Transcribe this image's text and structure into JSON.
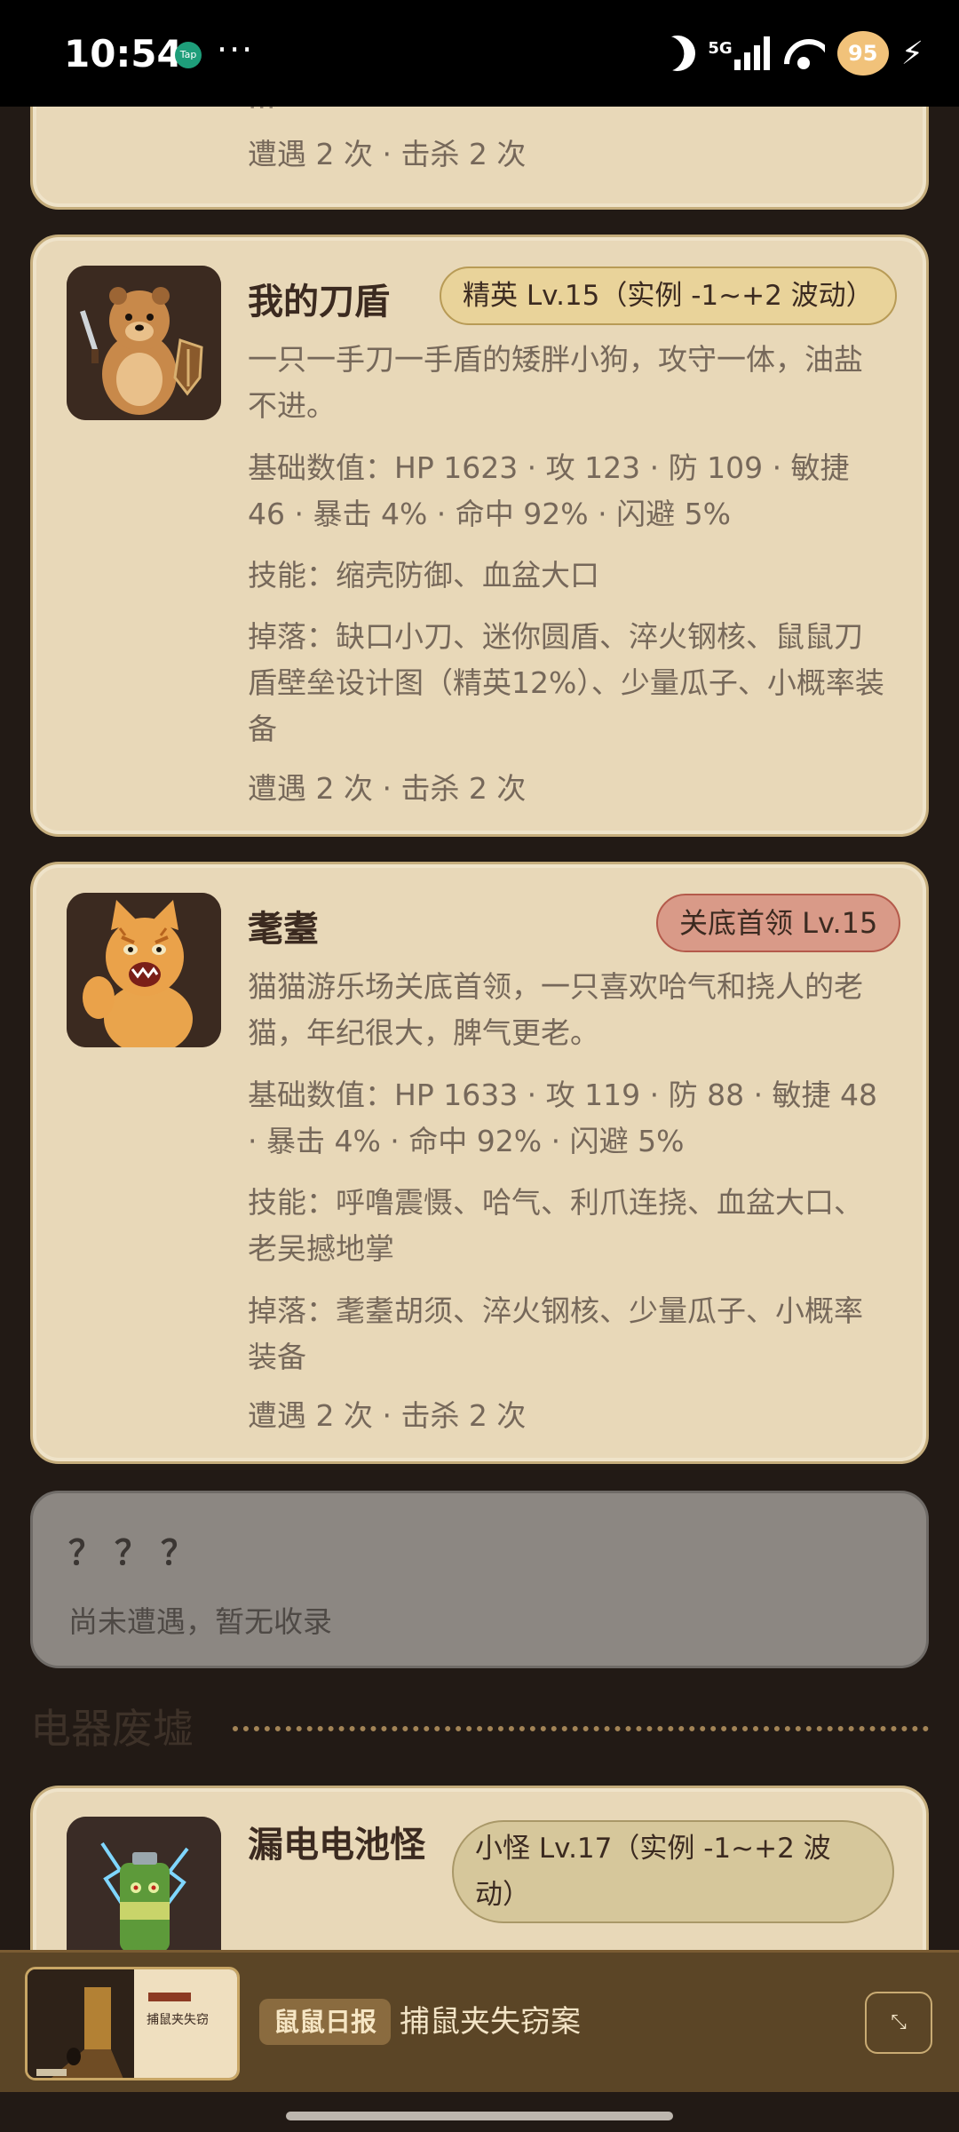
{
  "status_bar": {
    "time": "10:54",
    "app_badge": "Tap",
    "dots": "···",
    "network": "5G",
    "battery": "95",
    "icons": [
      "moon-icon",
      "signal-icon",
      "wifi-icon",
      "battery-icon",
      "charging-icon"
    ]
  },
  "cards": [
    {
      "encounter": "遭遇 2 次 · 击杀 2 次",
      "partial_text": "..."
    },
    {
      "name": "我的刀盾",
      "badge": "精英 Lv.15（实例 -1~+2 波动）",
      "description": "一只一手刀一手盾的矮胖小狗，攻守一体，油盐不进。",
      "stats": "基础数值：HP 1623 · 攻 123 · 防 109 · 敏捷 46 · 暴击 4% · 命中 92% · 闪避 5%",
      "skills": "技能：缩壳防御、血盆大口",
      "drops": "掉落：缺口小刀、迷你圆盾、淬火钢核、鼠鼠刀盾壁垒设计图（精英12%）、少量瓜子、小概率装备",
      "encounter": "遭遇 2 次 · 击杀 2 次"
    },
    {
      "name": "耄耋",
      "badge": "关底首领 Lv.15",
      "description": "猫猫游乐场关底首领，一只喜欢哈气和挠人的老猫，年纪很大，脾气更老。",
      "stats": "基础数值：HP 1633 · 攻 119 · 防 88 · 敏捷 48 · 暴击 4% · 命中 92% · 闪避 5%",
      "skills": "技能：呼噜震慑、哈气、利爪连挠、血盆大口、老吴撼地掌",
      "drops": "掉落：耄耋胡须、淬火钢核、少量瓜子、小概率装备",
      "encounter": "遭遇 2 次 · 击杀 2 次"
    },
    {
      "name": "？？？",
      "subtitle": "尚未遭遇，暂无收录"
    },
    {
      "name": "漏电电池怪",
      "badge": "小怪 Lv.17（实例 -1~+2 波动）"
    }
  ],
  "section": {
    "title": "电器废墟"
  },
  "news": {
    "thumb_title": "捕鼠夹失窃",
    "tag": "鼠鼠日报",
    "title": "捕鼠夹失窃案",
    "expand_icon": "expand-icon"
  },
  "colors": {
    "background": "#221a15",
    "card": "#e8d8b8",
    "card_border": "#c5ad7c",
    "elite_badge": "#e9d39a",
    "boss_badge": "#d99a88",
    "news_bar": "#5b4526"
  }
}
